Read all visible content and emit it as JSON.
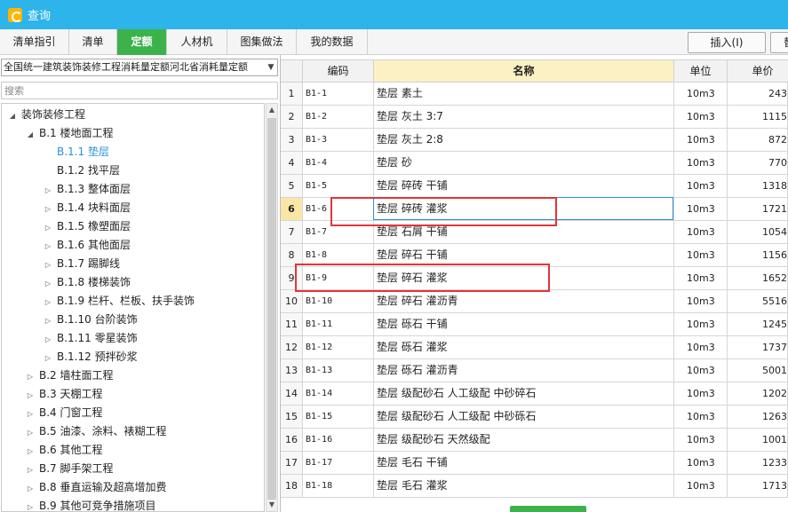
{
  "window": {
    "title": "查询"
  },
  "tabs": [
    {
      "label": "清单指引",
      "active": false
    },
    {
      "label": "清单",
      "active": false
    },
    {
      "label": "定额",
      "active": true
    },
    {
      "label": "人材机",
      "active": false
    },
    {
      "label": "图集做法",
      "active": false
    },
    {
      "label": "我的数据",
      "active": false
    }
  ],
  "toolbar": {
    "insert_label": "插入(I)",
    "replace_label": "替"
  },
  "left": {
    "quota_library": "全国统一建筑装饰装修工程消耗量定额河北省消耗量定额",
    "search_placeholder": "搜索",
    "tree": [
      {
        "label": "装饰装修工程",
        "level": 0,
        "expanded": true
      },
      {
        "label": "B.1 楼地面工程",
        "level": 1,
        "expanded": true
      },
      {
        "label": "B.1.1 垫层",
        "level": 2,
        "leaf": true,
        "selected": true
      },
      {
        "label": "B.1.2 找平层",
        "level": 2,
        "leaf": true
      },
      {
        "label": "B.1.3 整体面层",
        "level": 2
      },
      {
        "label": "B.1.4 块料面层",
        "level": 2
      },
      {
        "label": "B.1.5 橡塑面层",
        "level": 2
      },
      {
        "label": "B.1.6 其他面层",
        "level": 2
      },
      {
        "label": "B.1.7 踢脚线",
        "level": 2
      },
      {
        "label": "B.1.8 楼梯装饰",
        "level": 2
      },
      {
        "label": "B.1.9 栏杆、栏板、扶手装饰",
        "level": 2
      },
      {
        "label": "B.1.10 台阶装饰",
        "level": 2
      },
      {
        "label": "B.1.11 零星装饰",
        "level": 2
      },
      {
        "label": "B.1.12 预拌砂浆",
        "level": 2
      },
      {
        "label": "B.2 墙柱面工程",
        "level": 1
      },
      {
        "label": "B.3 天棚工程",
        "level": 1
      },
      {
        "label": "B.4 门窗工程",
        "level": 1
      },
      {
        "label": "B.5 油漆、涂料、裱糊工程",
        "level": 1
      },
      {
        "label": "B.6 其他工程",
        "level": 1
      },
      {
        "label": "B.7 脚手架工程",
        "level": 1
      },
      {
        "label": "B.8 垂直运输及超高增加费",
        "level": 1
      },
      {
        "label": "B.9 其他可竞争措施项目",
        "level": 1
      }
    ]
  },
  "grid": {
    "columns": {
      "code": "编码",
      "name": "名称",
      "unit": "单位",
      "price": "单价"
    },
    "current_row": 6,
    "rows": [
      {
        "n": "1",
        "code": "B1-1",
        "name": "垫层 素土",
        "unit": "10m3",
        "price": "243"
      },
      {
        "n": "2",
        "code": "B1-2",
        "name": "垫层 灰土 3:7",
        "unit": "10m3",
        "price": "1115"
      },
      {
        "n": "3",
        "code": "B1-3",
        "name": "垫层 灰土 2:8",
        "unit": "10m3",
        "price": "872"
      },
      {
        "n": "4",
        "code": "B1-4",
        "name": "垫层 砂",
        "unit": "10m3",
        "price": "770"
      },
      {
        "n": "5",
        "code": "B1-5",
        "name": "垫层 碎砖 干铺",
        "unit": "10m3",
        "price": "1318"
      },
      {
        "n": "6",
        "code": "B1-6",
        "name": "垫层 碎砖 灌浆",
        "unit": "10m3",
        "price": "1721"
      },
      {
        "n": "7",
        "code": "B1-7",
        "name": "垫层 石屑 干铺",
        "unit": "10m3",
        "price": "1054"
      },
      {
        "n": "8",
        "code": "B1-8",
        "name": "垫层 碎石 干铺",
        "unit": "10m3",
        "price": "1156"
      },
      {
        "n": "9",
        "code": "B1-9",
        "name": "垫层 碎石 灌浆",
        "unit": "10m3",
        "price": "1652"
      },
      {
        "n": "10",
        "code": "B1-10",
        "name": "垫层 碎石 灌沥青",
        "unit": "10m3",
        "price": "5516"
      },
      {
        "n": "11",
        "code": "B1-11",
        "name": "垫层 砾石 干铺",
        "unit": "10m3",
        "price": "1245"
      },
      {
        "n": "12",
        "code": "B1-12",
        "name": "垫层 砾石 灌浆",
        "unit": "10m3",
        "price": "1737"
      },
      {
        "n": "13",
        "code": "B1-13",
        "name": "垫层 砾石 灌沥青",
        "unit": "10m3",
        "price": "5001"
      },
      {
        "n": "14",
        "code": "B1-14",
        "name": "垫层 级配砂石 人工级配 中砂碎石",
        "unit": "10m3",
        "price": "1202"
      },
      {
        "n": "15",
        "code": "B1-15",
        "name": "垫层 级配砂石 人工级配 中砂砾石",
        "unit": "10m3",
        "price": "1263"
      },
      {
        "n": "16",
        "code": "B1-16",
        "name": "垫层 级配砂石 天然级配",
        "unit": "10m3",
        "price": "1001"
      },
      {
        "n": "17",
        "code": "B1-17",
        "name": "垫层 毛石 干铺",
        "unit": "10m3",
        "price": "1233"
      },
      {
        "n": "18",
        "code": "B1-18",
        "name": "垫层 毛石 灌浆",
        "unit": "10m3",
        "price": "1713"
      }
    ]
  },
  "colors": {
    "titlebar": "#2db4ea",
    "active_tab": "#3cb34a",
    "highlight_box": "#e0353b",
    "selected_tree": "#2a8fd8"
  }
}
